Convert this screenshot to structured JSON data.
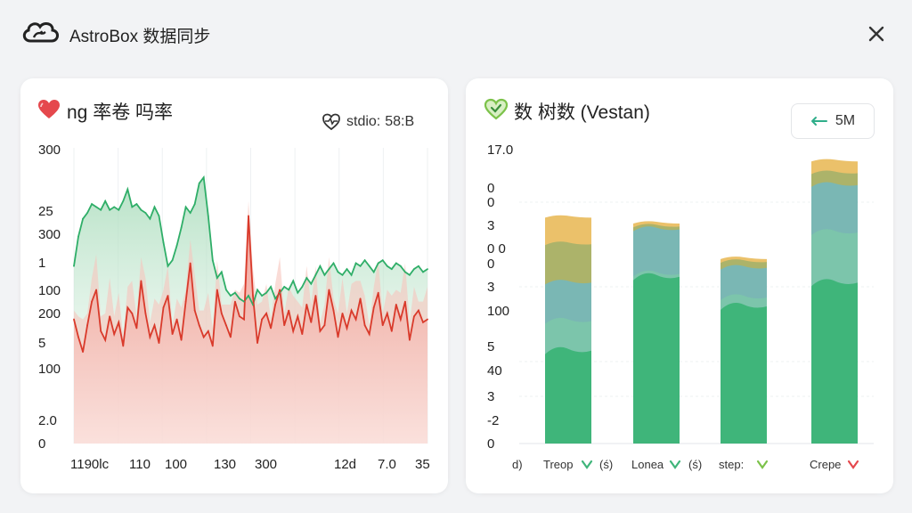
{
  "app": {
    "title": "AstroBox 数据同步",
    "icons": {
      "logo": "cloud-sync-logo",
      "close": "close-icon"
    }
  },
  "left_panel": {
    "title": "ng 率卷 吗率",
    "icon": "heart-icon",
    "status_label": "stdio:",
    "status_value": "58:B",
    "status_icon": "heart-pulse-icon",
    "colors": {
      "heart": "#e5484d",
      "line_red": "#d93a2b",
      "line_green": "#2fae68",
      "fill_red": "#f3b3aa",
      "fill_green": "#bfe6cd"
    }
  },
  "right_panel": {
    "title": "数 树数 (Vestan)",
    "icon": "heart-check-icon",
    "range_label": "5M",
    "range_icon": "arrow-left-icon",
    "colors": {
      "heart": "#7cc24a"
    }
  },
  "chart_data": [
    {
      "type": "line",
      "y_tick_labels": [
        "300",
        "25",
        "300",
        "1",
        "100",
        "200",
        "5",
        "100",
        "2.0",
        "0"
      ],
      "x_tick_labels": [
        "1190lc",
        "110",
        "100",
        "130",
        "300",
        "12d",
        "7.0",
        "35"
      ],
      "series": [
        {
          "values": [
            0.42,
            0.36,
            0.31,
            0.4,
            0.48,
            0.52,
            0.38,
            0.35,
            0.43,
            0.37,
            0.41,
            0.33,
            0.46,
            0.44,
            0.39,
            0.55,
            0.44,
            0.36,
            0.4,
            0.34,
            0.46,
            0.5,
            0.37,
            0.42,
            0.35,
            0.48,
            0.61,
            0.45,
            0.4,
            0.36,
            0.38,
            0.33,
            0.52,
            0.44,
            0.4,
            0.36,
            0.48,
            0.43,
            0.42,
            0.77,
            0.5,
            0.34,
            0.42,
            0.44,
            0.39,
            0.47,
            0.52,
            0.4,
            0.45,
            0.38,
            0.43,
            0.37,
            0.47,
            0.41,
            0.5,
            0.38,
            0.4,
            0.52,
            0.45,
            0.36,
            0.44,
            0.39,
            0.45,
            0.42,
            0.49,
            0.4,
            0.37,
            0.46,
            0.51,
            0.4,
            0.44,
            0.38,
            0.47,
            0.42,
            0.48,
            0.35,
            0.43,
            0.45,
            0.41,
            0.42
          ]
        },
        {
          "values": [
            0.6,
            0.7,
            0.76,
            0.78,
            0.81,
            0.8,
            0.79,
            0.82,
            0.79,
            0.8,
            0.79,
            0.82,
            0.86,
            0.8,
            0.81,
            0.79,
            0.78,
            0.76,
            0.8,
            0.77,
            0.68,
            0.6,
            0.62,
            0.67,
            0.73,
            0.8,
            0.78,
            0.81,
            0.88,
            0.9,
            0.77,
            0.62,
            0.56,
            0.58,
            0.52,
            0.5,
            0.51,
            0.49,
            0.48,
            0.5,
            0.47,
            0.52,
            0.5,
            0.51,
            0.53,
            0.49,
            0.51,
            0.53,
            0.52,
            0.55,
            0.51,
            0.53,
            0.56,
            0.54,
            0.57,
            0.6,
            0.57,
            0.59,
            0.61,
            0.58,
            0.57,
            0.59,
            0.57,
            0.61,
            0.6,
            0.62,
            0.6,
            0.58,
            0.61,
            0.62,
            0.6,
            0.59,
            0.61,
            0.6,
            0.58,
            0.57,
            0.59,
            0.6,
            0.58,
            0.59
          ]
        }
      ]
    },
    {
      "type": "area",
      "y_tick_labels": [
        "17.0",
        "0",
        "0",
        "3",
        "0 0",
        "0",
        "3",
        "100",
        "5",
        "40",
        "3",
        "-2",
        "0"
      ],
      "categories": [
        "Treop",
        "Lonea",
        "step:",
        "Crepe"
      ],
      "x_prefix_labels": [
        "d)",
        "(ś)",
        "(ś)",
        ""
      ],
      "series": [
        {
          "color": "#3fb57a",
          "values": [
            0.32,
            0.57,
            0.47,
            0.55
          ]
        },
        {
          "color": "#7cc9a8",
          "values": [
            0.42,
            0.58,
            0.5,
            0.72
          ]
        },
        {
          "color": "#6bb9c9",
          "values": [
            0.55,
            0.73,
            0.6,
            0.88
          ]
        },
        {
          "color": "#9ab06a",
          "values": [
            0.68,
            0.74,
            0.62,
            0.92
          ]
        },
        {
          "color": "#e6b040",
          "values": [
            0.77,
            0.75,
            0.63,
            0.96
          ]
        }
      ],
      "legend_marks": [
        {
          "color": "#3fb57a",
          "symbol": "down-check"
        },
        {
          "color": "#3fb57a",
          "symbol": "down-check"
        },
        {
          "color": "#7cc24a",
          "symbol": "down-check"
        },
        {
          "color": "#e5484d",
          "symbol": "down-check"
        }
      ]
    }
  ]
}
